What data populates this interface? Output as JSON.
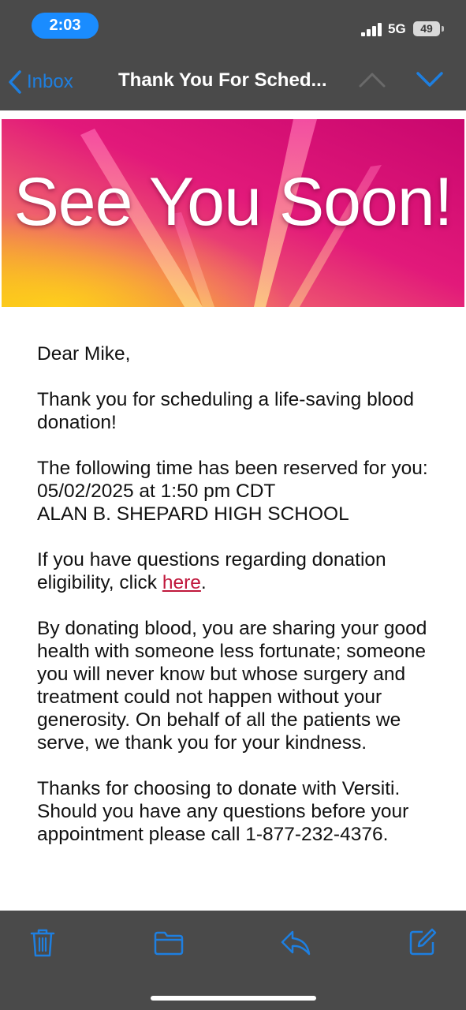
{
  "status_bar": {
    "time": "2:03",
    "network": "5G",
    "battery": "49"
  },
  "nav": {
    "back_label": "Inbox",
    "title": "Thank You For Sched...",
    "back_icon": "chevron-left-icon",
    "up_icon": "chevron-up-icon",
    "down_icon": "chevron-down-icon"
  },
  "banner": {
    "text": "See You Soon!",
    "colors": {
      "magenta": "#e0106e",
      "pink": "#f0408a",
      "yellow": "#f7c21a"
    }
  },
  "email": {
    "greeting": "Dear Mike,",
    "thanks": "Thank you for scheduling a life-saving blood donation!",
    "reserved_intro": "The following time has been reserved for you:",
    "appointment_time": "05/02/2025 at 1:50 pm CDT",
    "location": "ALAN B. SHEPARD HIGH SCHOOL",
    "questions_prefix": "If you have questions regarding donation eligibility, click ",
    "questions_link": "here",
    "questions_suffix": ".",
    "donating_paragraph": "By donating blood, you are sharing your good health with someone less fortunate; someone you will never know but whose surgery and treatment could not happen without your generosity.  On behalf of all the patients we serve, we thank you for your kindness.",
    "closing_paragraph": "Thanks for choosing to donate with Versiti. Should you have any questions before your appointment please call 1-877-232-4376."
  },
  "toolbar": {
    "icons": [
      "trash-icon",
      "folder-icon",
      "reply-icon",
      "compose-icon"
    ],
    "accent": "#1e7fe0"
  }
}
